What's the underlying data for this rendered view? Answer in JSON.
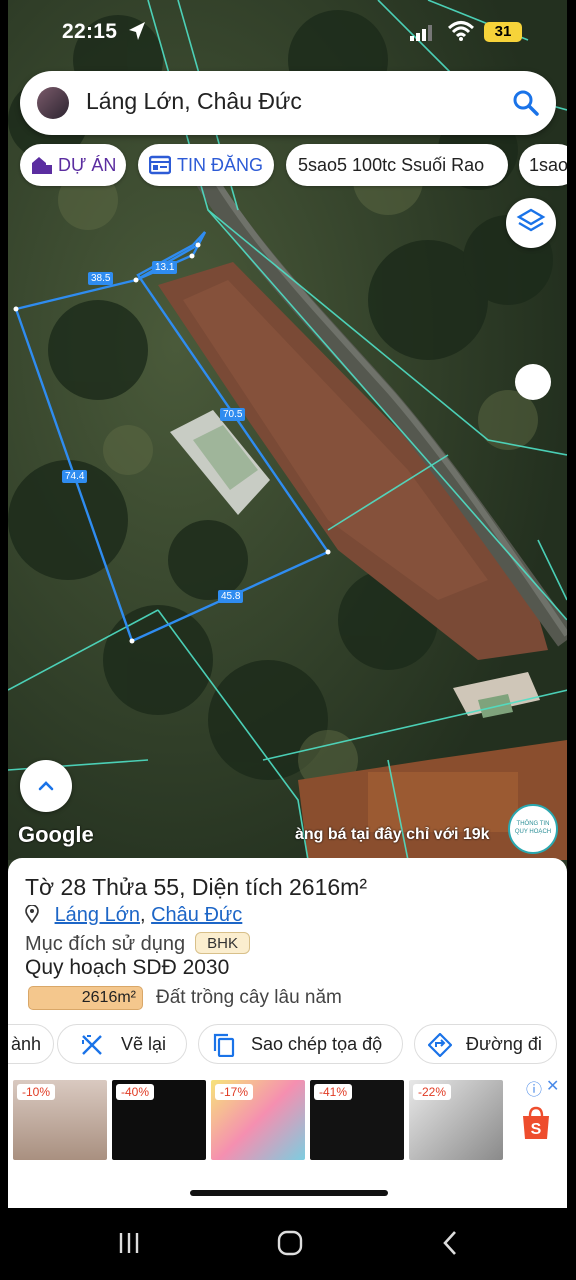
{
  "status_bar": {
    "time": "22:15",
    "battery": "31"
  },
  "search": {
    "query": "Láng Lớn, Châu Đức"
  },
  "chips": [
    {
      "label": "DỰ ÁN"
    },
    {
      "label": "TIN ĐĂNG"
    },
    {
      "label": "5sao5 100tc Ssuối Rao"
    },
    {
      "label": "1sao"
    }
  ],
  "map": {
    "edge_labels": [
      "38.5",
      "13.1",
      "70.5",
      "74.4",
      "45.8"
    ],
    "google_logo": "Google",
    "ticker": "àng bá tại đây chỉ với 19k",
    "brand_logo_text": "THÔNG TIN QUY HOẠCH"
  },
  "parcel": {
    "title": "Tờ 28 Thửa 55, Diện tích 2616m²",
    "ward": "Láng Lớn",
    "separator": ",",
    "district": "Châu Đức",
    "purpose_label": "Mục đích sử dụng",
    "purpose_code": "BHK",
    "plan_title": "Quy hoạch SDĐ 2030",
    "plan_area": "2616m²",
    "plan_use": "Đất trồng cây lâu năm",
    "plan_fraction": 1.0
  },
  "actions": [
    {
      "label": "ành"
    },
    {
      "label": "Vẽ lại"
    },
    {
      "label": "Sao chép tọa độ"
    },
    {
      "label": "Đường đi"
    }
  ],
  "ads": [
    {
      "discount": "-10%"
    },
    {
      "discount": "-40%"
    },
    {
      "discount": "-17%"
    },
    {
      "discount": "-41%"
    },
    {
      "discount": "-22%"
    }
  ],
  "ad_tag": "ⓘ",
  "ad_close": "✕",
  "colors": {
    "parcel_line": "#2f8cf0",
    "cadastral_line": "#4fe0c6",
    "accent_blue": "#1d66c7",
    "plan_fill": "#f4c78d"
  }
}
